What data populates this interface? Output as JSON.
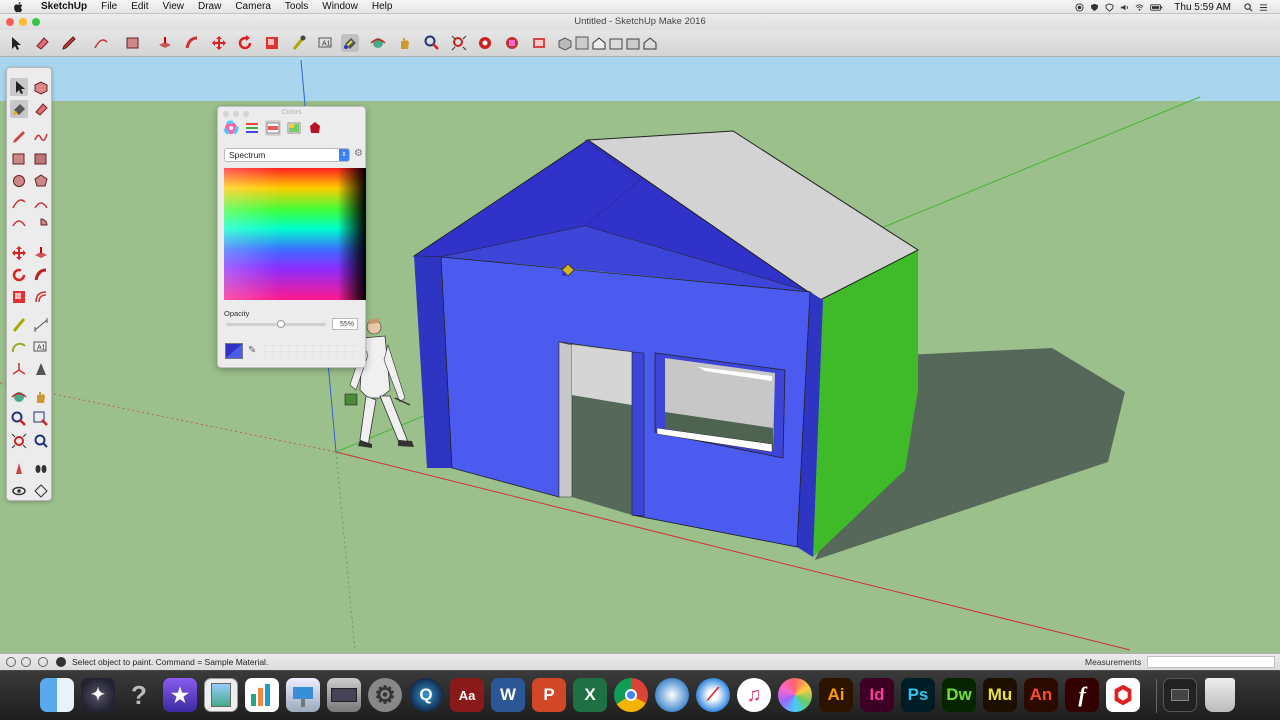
{
  "menubar": {
    "app_name": "SketchUp",
    "items": [
      "File",
      "Edit",
      "View",
      "Draw",
      "Camera",
      "Tools",
      "Window",
      "Help"
    ],
    "clock": "Thu 5:59 AM"
  },
  "window": {
    "title": "Untitled - SketchUp Make 2016"
  },
  "toolbar": {
    "tools": [
      "select-icon",
      "eraser-icon",
      "pencil-icon",
      "arc-icon",
      "rectangle-icon",
      "push-pull-icon",
      "follow-me-icon",
      "move-icon",
      "rotate-icon",
      "scale-icon",
      "tape-measure-icon",
      "text-icon",
      "paint-bucket-icon",
      "orbit-icon",
      "pan-icon",
      "zoom-icon",
      "zoom-extents-icon",
      "warehouse-icon",
      "extension-icon",
      "components-icon",
      "view-iso-icon",
      "view-top-icon",
      "view-front-icon",
      "view-right-icon",
      "view-back-icon",
      "view-left-icon"
    ],
    "active_tool": "paint-bucket-icon"
  },
  "colors_panel": {
    "title": "Colors",
    "modes": [
      "color-wheel-icon",
      "color-sliders-icon",
      "color-palettes-icon",
      "image-palettes-icon",
      "crayons-icon"
    ],
    "active_mode": "color-palettes-icon",
    "palette_select": "Spectrum",
    "opacity_label": "Opacity",
    "opacity_value": "55%",
    "opacity_fraction": 0.55,
    "current_color": "#3132c9"
  },
  "scene": {
    "colors": {
      "sky": "#a9d6ee",
      "ground": "#9cc08c",
      "wall_blue": "#4b5bf0",
      "wall_blue_dark": "#3d45d8",
      "roof_blue": "#3132c9",
      "roof_white": "#d3d3d3",
      "side_green": "#3fbb2a",
      "shadow": "#56685a"
    }
  },
  "statusbar": {
    "message": "Select object to paint. Command = Sample Material.",
    "measurements_label": "Measurements",
    "measurements_value": ""
  },
  "dock": {
    "apps": [
      {
        "name": "finder",
        "label": ""
      },
      {
        "name": "launchpad",
        "label": ""
      },
      {
        "name": "help",
        "label": "?"
      },
      {
        "name": "imovie",
        "label": "★"
      },
      {
        "name": "preview",
        "label": ""
      },
      {
        "name": "numbers",
        "label": ""
      },
      {
        "name": "keynote",
        "label": ""
      },
      {
        "name": "scanner",
        "label": ""
      },
      {
        "name": "system-preferences",
        "label": "⚙"
      },
      {
        "name": "quicktime",
        "label": "Q"
      },
      {
        "name": "acrobat",
        "label": "Aa"
      },
      {
        "name": "word",
        "label": "W"
      },
      {
        "name": "powerpoint",
        "label": "P"
      },
      {
        "name": "excel",
        "label": "X"
      },
      {
        "name": "chrome",
        "label": ""
      },
      {
        "name": "comix",
        "label": ""
      },
      {
        "name": "safari",
        "label": ""
      },
      {
        "name": "itunes",
        "label": "♫"
      },
      {
        "name": "photos",
        "label": ""
      },
      {
        "name": "illustrator",
        "label": "Ai"
      },
      {
        "name": "indesign",
        "label": "Id"
      },
      {
        "name": "photoshop",
        "label": "Ps"
      },
      {
        "name": "dreamweaver",
        "label": "Dw"
      },
      {
        "name": "muse",
        "label": "Mu"
      },
      {
        "name": "animate",
        "label": "An"
      },
      {
        "name": "flash-player",
        "label": "f"
      },
      {
        "name": "sketchup",
        "label": ""
      },
      {
        "name": "terminal",
        "label": ""
      },
      {
        "name": "trash",
        "label": ""
      }
    ]
  }
}
